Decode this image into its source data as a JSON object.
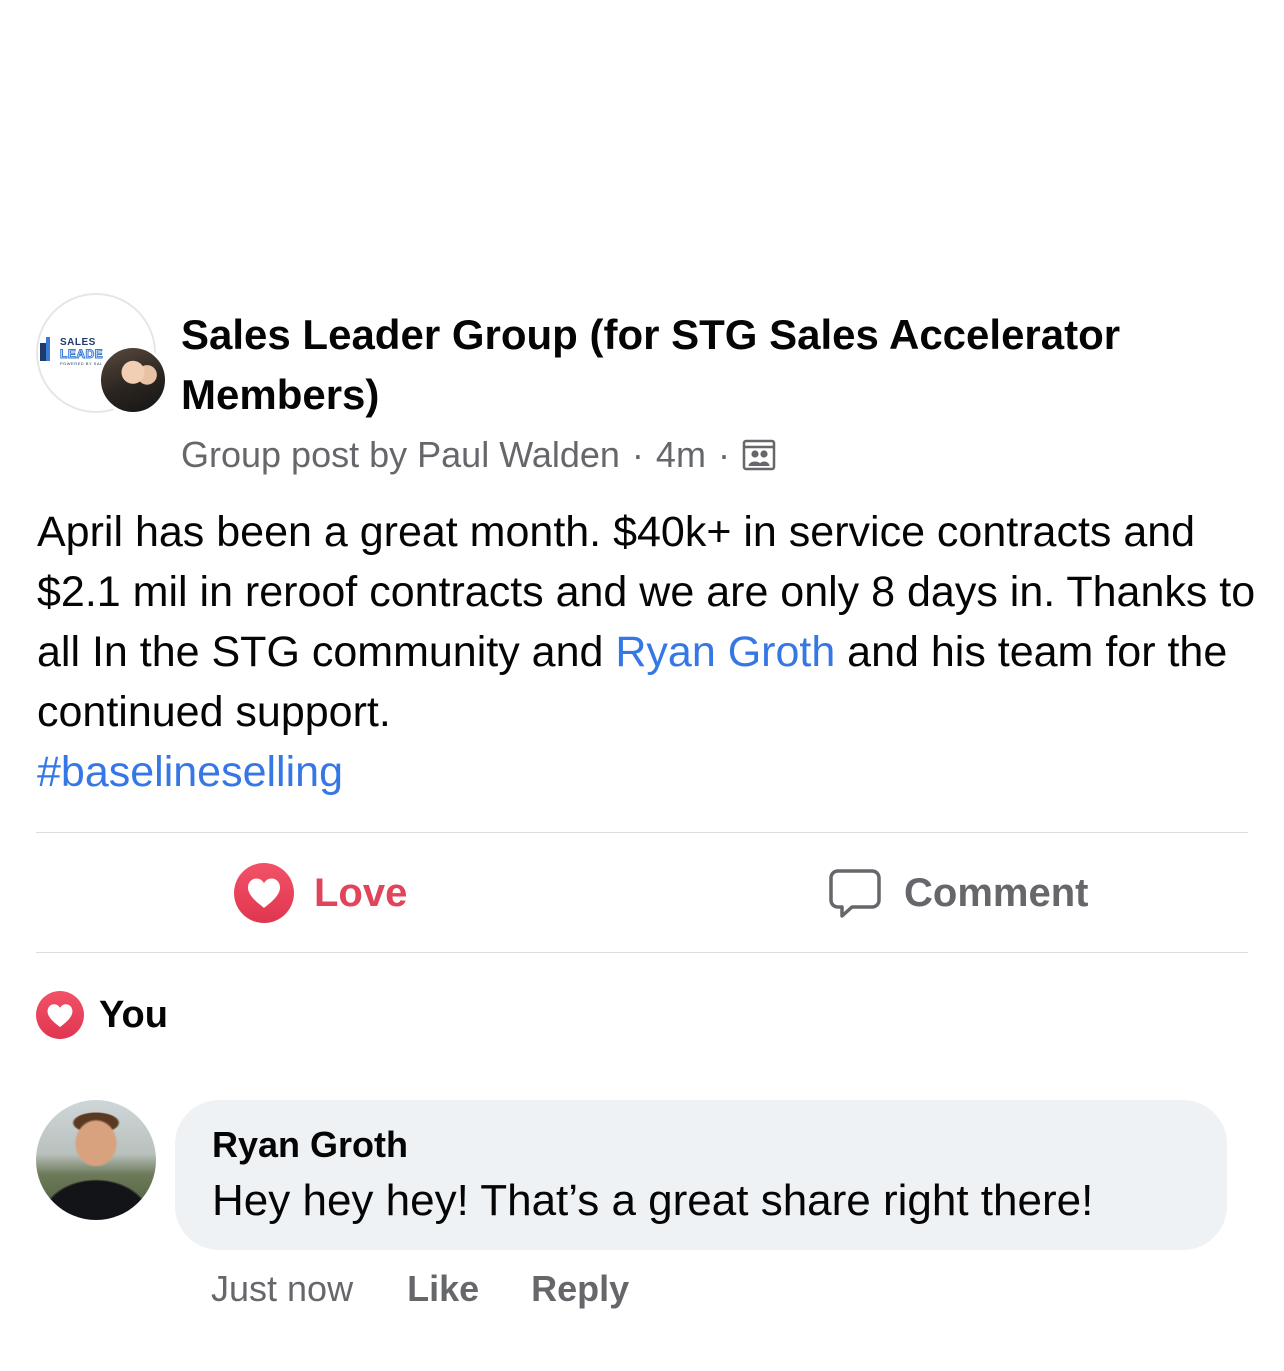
{
  "header": {
    "group_name": "Sales Leader Group (for STG Sales Accelerator Members)",
    "logo_text_top": "SALES",
    "logo_text_bottom": "LEADE",
    "logo_text_small": "POWERED BY SAL",
    "post_type_prefix": "Group post by",
    "author": "Paul Walden",
    "separator": "·",
    "time": "4m",
    "audience_icon": "group-members-icon"
  },
  "post": {
    "text_before_mention": "April has been a great month. $40k+ in service contracts and $2.1 mil in reroof contracts and we are only 8 days in. Thanks to all In the STG community and ",
    "mention": "Ryan Groth",
    "text_after_mention": " and his team for the continued support.",
    "hashtag": "#baselineselling"
  },
  "actions": {
    "love_label": "Love",
    "love_icon": "heart-icon",
    "comment_label": "Comment",
    "comment_icon": "speech-bubble-icon"
  },
  "reactions": {
    "label": "You",
    "icon": "heart-icon"
  },
  "comment": {
    "author": "Ryan Groth",
    "text": "Hey hey hey! That’s a great share right there!",
    "time": "Just now",
    "like_label": "Like",
    "reply_label": "Reply"
  },
  "colors": {
    "love": "#e0455c",
    "link": "#3578e5",
    "secondary_text": "#65676b",
    "bubble": "#eff2f5"
  }
}
